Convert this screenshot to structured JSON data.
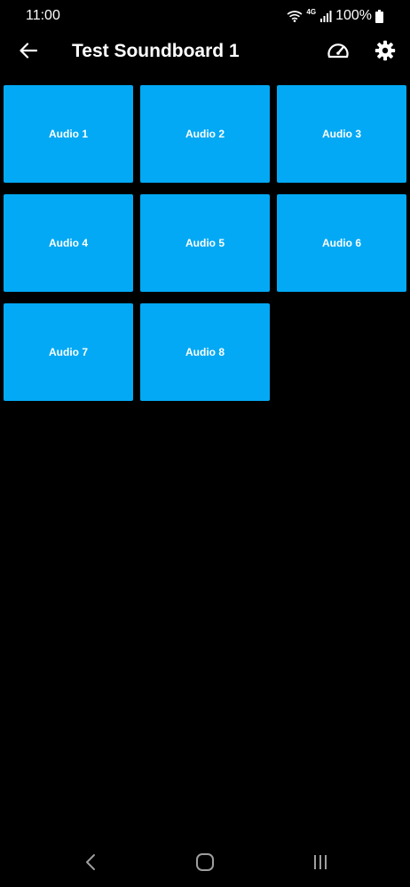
{
  "status_bar": {
    "time": "11:00",
    "network": "4G",
    "battery": "100%",
    "icons": [
      "wifi-icon",
      "network-4g-icon",
      "signal-icon",
      "battery-icon"
    ]
  },
  "app_bar": {
    "title": "Test Soundboard 1",
    "icons": [
      "back-arrow-icon",
      "speedometer-icon",
      "gear-icon"
    ]
  },
  "tiles": [
    {
      "label": "Audio 1"
    },
    {
      "label": "Audio 2"
    },
    {
      "label": "Audio 3"
    },
    {
      "label": "Audio 4"
    },
    {
      "label": "Audio 5"
    },
    {
      "label": "Audio 6"
    },
    {
      "label": "Audio 7"
    },
    {
      "label": "Audio 8"
    }
  ],
  "nav_bar": {
    "icons": [
      "nav-back-icon",
      "nav-home-icon",
      "nav-recents-icon"
    ]
  },
  "colors": {
    "background": "#000000",
    "tile": "#03a9f4",
    "text": "#ffffff"
  }
}
